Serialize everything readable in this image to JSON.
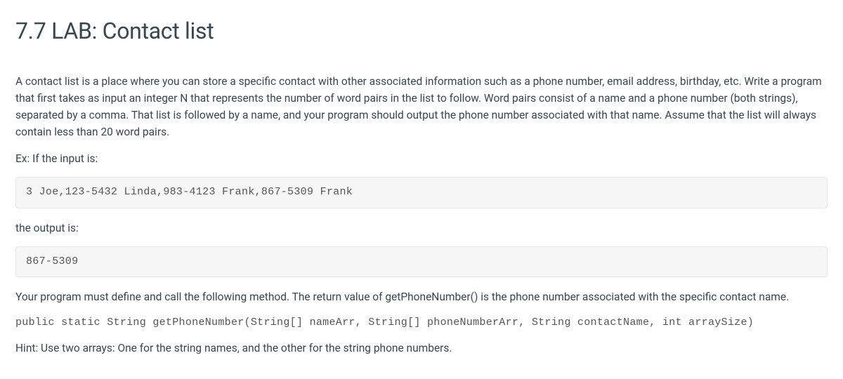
{
  "title": "7.7 LAB: Contact list",
  "intro_paragraph": "A contact list is a place where you can store a specific contact with other associated information such as a phone number, email address, birthday, etc. Write a program that first takes as input an integer N that represents the number of word pairs in the list to follow. Word pairs consist of a name and a phone number (both strings), separated by a comma. That list is followed by a name, and your program should output the phone number associated with that name. Assume that the list will always contain less than 20 word pairs.",
  "example_input_label": "Ex: If the input is:",
  "example_input_code": "3 Joe,123-5432 Linda,983-4123 Frank,867-5309 Frank",
  "example_output_label": "the output is:",
  "example_output_code": "867-5309",
  "method_paragraph": "Your program must define and call the following method. The return value of getPhoneNumber() is the phone number associated with the specific contact name.",
  "method_signature": "public static String getPhoneNumber(String[] nameArr, String[] phoneNumberArr, String contactName, int arraySize)",
  "hint": "Hint: Use two arrays: One for the string names, and the other for the string phone numbers."
}
